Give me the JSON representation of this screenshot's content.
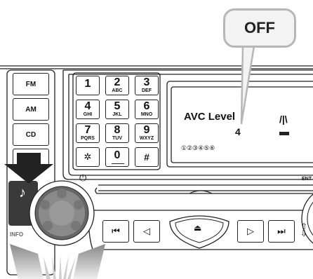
{
  "callout": {
    "label": "OFF"
  },
  "side_buttons": [
    {
      "label": "FM"
    },
    {
      "label": "AM"
    },
    {
      "label": "CD"
    }
  ],
  "keypad": [
    {
      "num": "1",
      "sub": ""
    },
    {
      "num": "2",
      "sub": "ABC"
    },
    {
      "num": "3",
      "sub": "DEF"
    },
    {
      "num": "4",
      "sub": "GHI"
    },
    {
      "num": "5",
      "sub": "JKL"
    },
    {
      "num": "6",
      "sub": "MNO"
    },
    {
      "num": "7",
      "sub": "PQRS"
    },
    {
      "num": "8",
      "sub": "TUV"
    },
    {
      "num": "9",
      "sub": "WXYZ"
    },
    {
      "num": "✲",
      "sub": ""
    },
    {
      "num": "0",
      "sub": ""
    },
    {
      "num": "#",
      "sub": ""
    }
  ],
  "display": {
    "title": "AVC Level",
    "value": "4",
    "presets": "①②③④⑤⑥",
    "indicator": "/|\\"
  },
  "labels": {
    "info": "INFO",
    "enter": "ENT"
  },
  "icons": {
    "power": "power-icon",
    "music": "music-note-icon",
    "prev_track": "previous-track-icon",
    "seek_back": "seek-back-icon",
    "eject": "eject-icon",
    "seek_forward": "seek-forward-icon",
    "next_track": "next-track-icon",
    "arrow_down": "down-arrow-icon",
    "rotate": "rotate-arrows-icon"
  }
}
